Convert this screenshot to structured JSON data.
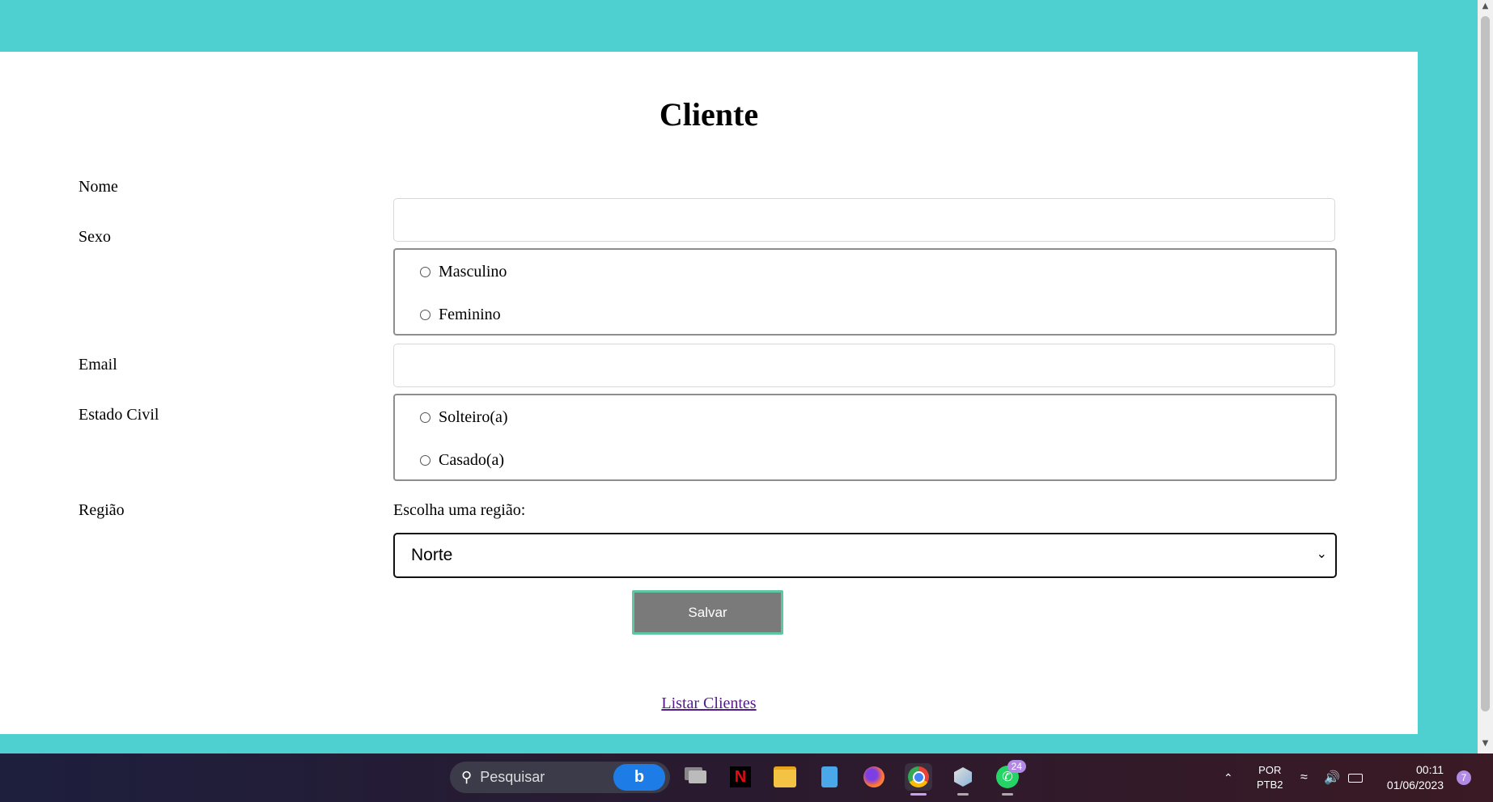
{
  "form": {
    "title": "Cliente",
    "nome_label": "Nome",
    "sexo_label": "Sexo",
    "sexo_options": [
      "Masculino",
      "Feminino"
    ],
    "email_label": "Email",
    "estado_civil_label": "Estado Civil",
    "estado_civil_options": [
      "Solteiro(a)",
      "Casado(a)"
    ],
    "regiao_label": "Região",
    "regiao_prompt": "Escolha uma região:",
    "regiao_selected": "Norte",
    "save_label": "Salvar",
    "list_link": "Listar Clientes"
  },
  "taskbar": {
    "search_placeholder": "Pesquisar",
    "bing_label": "b",
    "whatsapp_badge": "24",
    "lang_top": "POR",
    "lang_bottom": "PTB2",
    "time": "00:11",
    "date": "01/06/2023",
    "notification_count": "7"
  },
  "colors": {
    "background": "#4dd0cf",
    "save_button": "#7a7a7a",
    "save_border": "#5ec6a5",
    "link": "#551a8b"
  }
}
